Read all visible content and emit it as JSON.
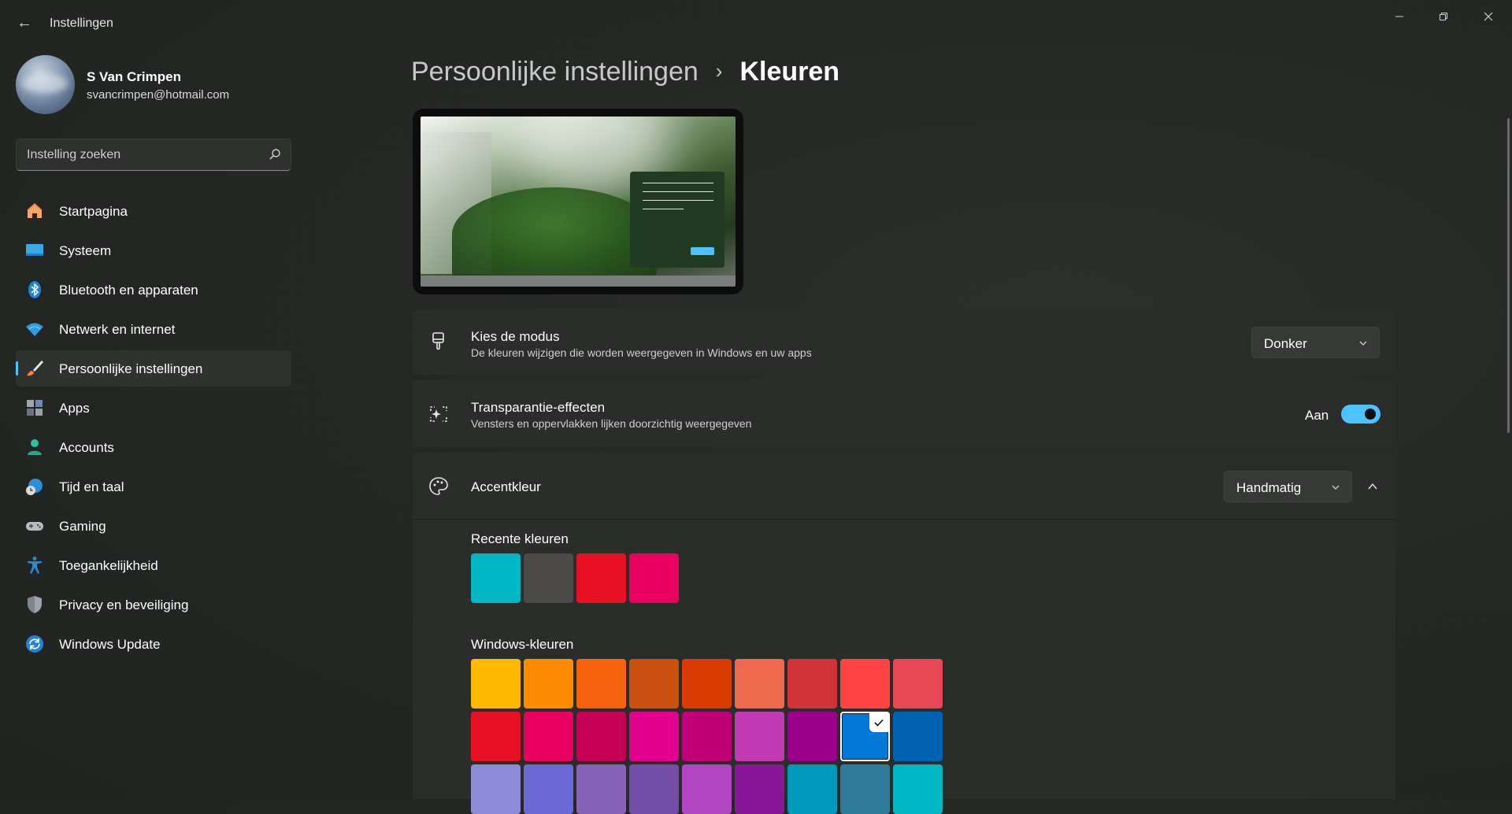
{
  "window": {
    "title": "Instellingen"
  },
  "profile": {
    "name": "S Van Crimpen",
    "email": "svancrimpen@hotmail.com"
  },
  "search": {
    "placeholder": "Instelling zoeken"
  },
  "nav": {
    "items": [
      {
        "label": "Startpagina",
        "icon": "home-icon"
      },
      {
        "label": "Systeem",
        "icon": "monitor-icon"
      },
      {
        "label": "Bluetooth en apparaten",
        "icon": "bluetooth-icon"
      },
      {
        "label": "Netwerk en internet",
        "icon": "wifi-icon"
      },
      {
        "label": "Persoonlijke instellingen",
        "icon": "brush-icon",
        "active": true
      },
      {
        "label": "Apps",
        "icon": "apps-icon"
      },
      {
        "label": "Accounts",
        "icon": "person-icon"
      },
      {
        "label": "Tijd en taal",
        "icon": "globe-clock-icon"
      },
      {
        "label": "Gaming",
        "icon": "gamepad-icon"
      },
      {
        "label": "Toegankelijkheid",
        "icon": "accessibility-icon"
      },
      {
        "label": "Privacy en beveiliging",
        "icon": "shield-icon"
      },
      {
        "label": "Windows Update",
        "icon": "update-icon"
      }
    ]
  },
  "breadcrumb": {
    "parent": "Persoonlijke instellingen",
    "separator": "›",
    "current": "Kleuren"
  },
  "mode": {
    "title": "Kies de modus",
    "subtitle": "De kleuren wijzigen die worden weergegeven in Windows en uw apps",
    "value": "Donker"
  },
  "transparency": {
    "title": "Transparantie-effecten",
    "subtitle": "Vensters en oppervlakken lijken doorzichtig weergegeven",
    "state_label": "Aan",
    "on": true
  },
  "accent": {
    "title": "Accentkleur",
    "value": "Handmatig",
    "expanded": true
  },
  "recent_colors": {
    "title": "Recente kleuren",
    "colors": [
      "#00b7c3",
      "#4c4a48",
      "#e81123",
      "#ea005e"
    ]
  },
  "windows_colors": {
    "title": "Windows-kleuren",
    "selected_index": 16,
    "colors": [
      "#ffb900",
      "#ff8c00",
      "#f7630c",
      "#ca5010",
      "#da3b01",
      "#ef6950",
      "#d13438",
      "#ff4343",
      "#e74856",
      "#e81123",
      "#ea005e",
      "#c30052",
      "#e3008c",
      "#bf0077",
      "#c239b3",
      "#9a0089",
      "#0078d7",
      "#0063b1",
      "#8e8cd8",
      "#6b69d6",
      "#8764b8",
      "#744da9",
      "#b146c2",
      "#881798",
      "#0099bc",
      "#2d7d9a",
      "#00b7c3"
    ]
  },
  "theme": {
    "accent": "#4cc2ff",
    "background": "#202320",
    "card": "#2b2d2b"
  }
}
